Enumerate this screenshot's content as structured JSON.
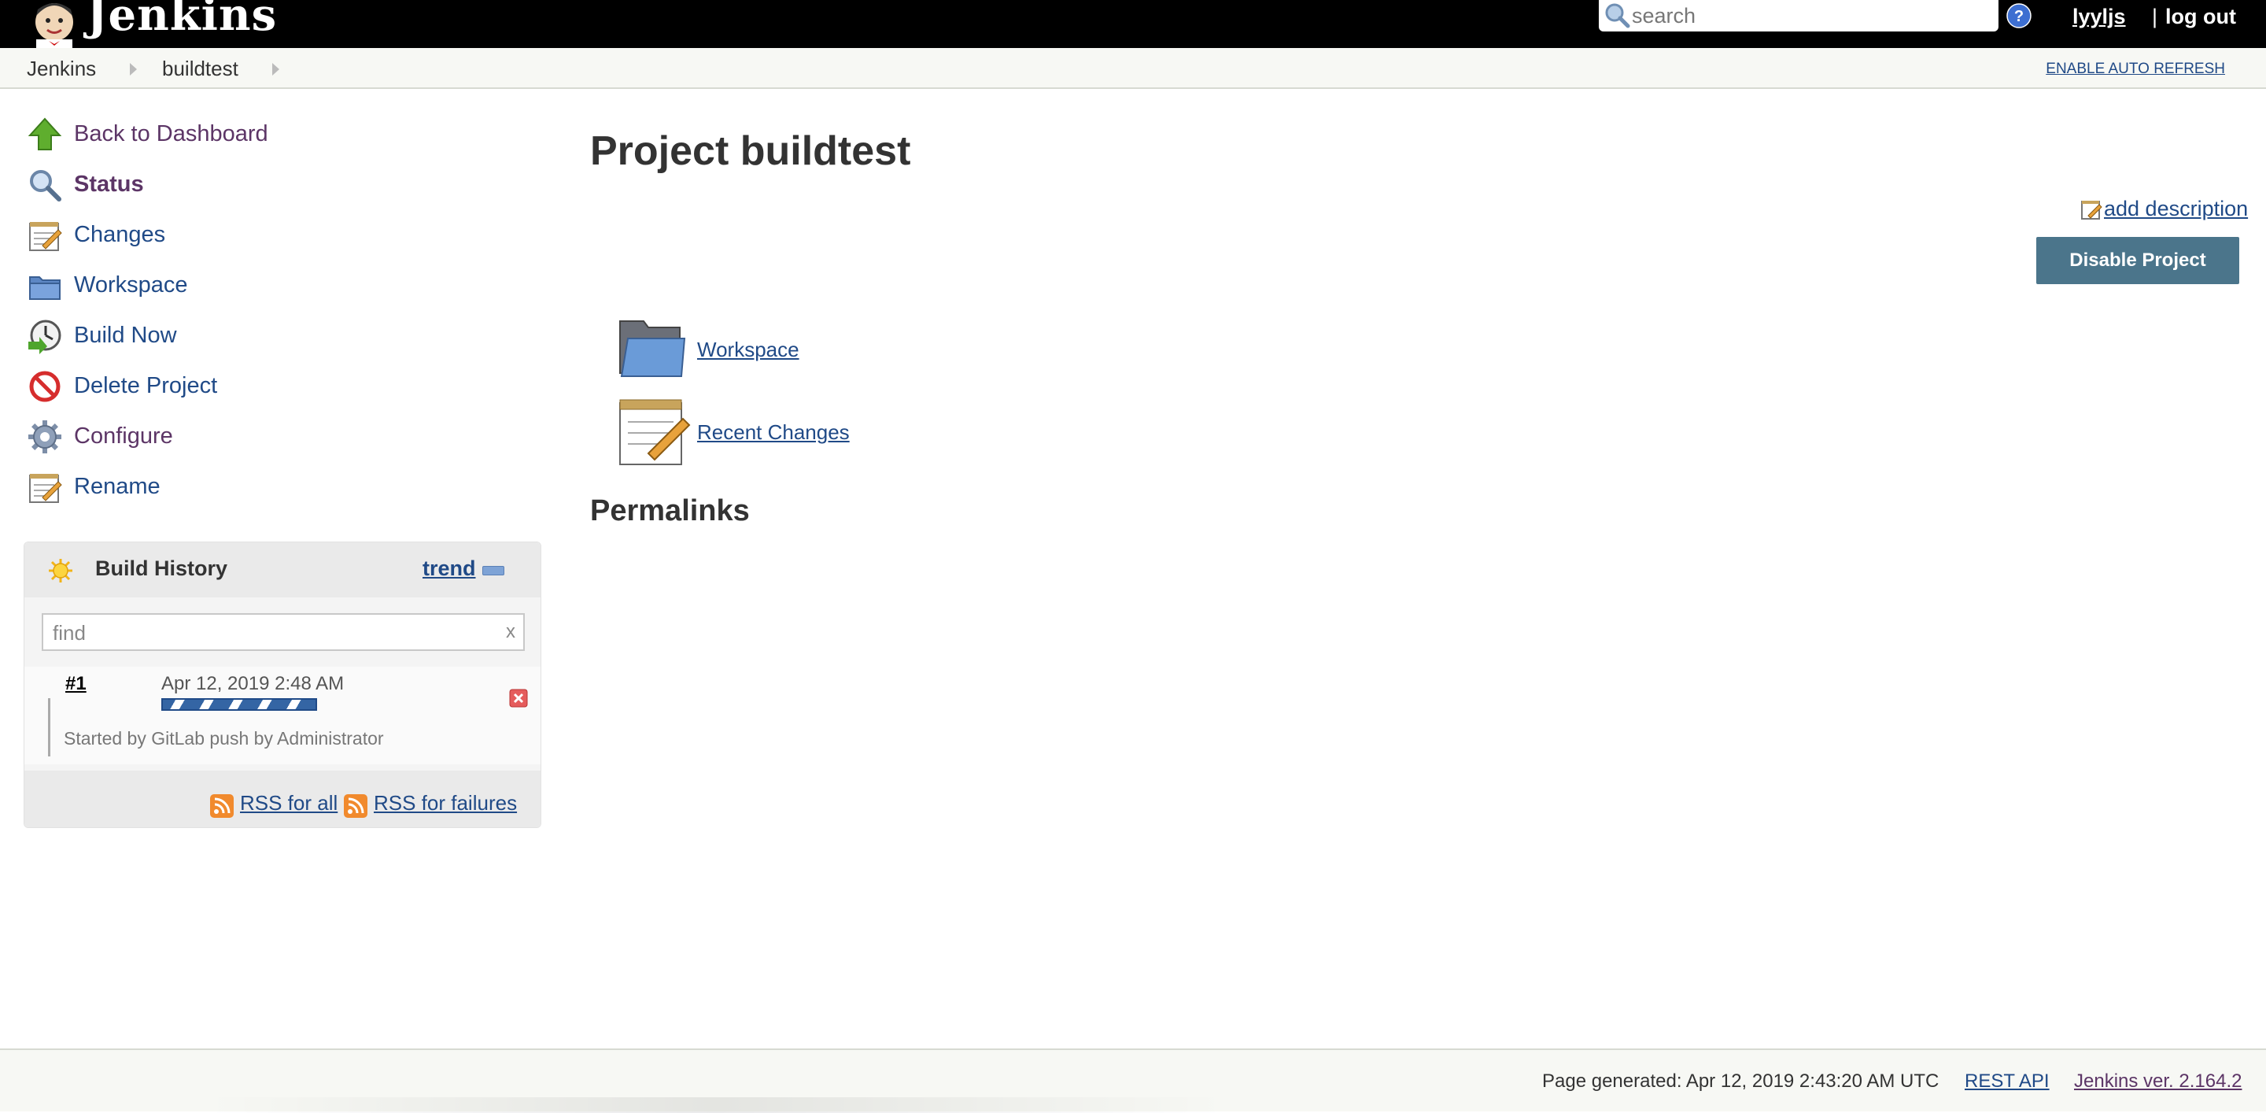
{
  "header": {
    "logo_title": "Jenkins",
    "search_placeholder": "search",
    "username": "lyyljs",
    "logout_separator": "|",
    "logout_label": "log out"
  },
  "breadcrumb": {
    "items": [
      "Jenkins",
      "buildtest"
    ],
    "auto_refresh_label": "ENABLE AUTO REFRESH"
  },
  "sidebar": {
    "tasks": [
      {
        "label": "Back to Dashboard",
        "icon": "up-arrow-icon"
      },
      {
        "label": "Status",
        "icon": "magnifier-icon"
      },
      {
        "label": "Changes",
        "icon": "notepad-icon"
      },
      {
        "label": "Workspace",
        "icon": "folder-icon"
      },
      {
        "label": "Build Now",
        "icon": "clock-icon"
      },
      {
        "label": "Delete Project",
        "icon": "no-entry-icon"
      },
      {
        "label": "Configure",
        "icon": "gear-icon"
      },
      {
        "label": "Rename",
        "icon": "notepad-icon"
      }
    ]
  },
  "build_history": {
    "title": "Build History",
    "trend_label": "trend",
    "find_placeholder": "find",
    "find_clear": "x",
    "builds": [
      {
        "number": "#1",
        "date": "Apr 12, 2019 2:48 AM",
        "cause": "Started by GitLab push by Administrator"
      }
    ],
    "rss_all_label": "RSS for all",
    "rss_failures_label": "RSS for failures"
  },
  "main": {
    "title": "Project buildtest",
    "add_description_label": "add description",
    "disable_button_label": "Disable Project",
    "links": [
      {
        "label": "Workspace",
        "icon": "folder-icon"
      },
      {
        "label": "Recent Changes",
        "icon": "notepad-icon"
      }
    ],
    "permalinks_heading": "Permalinks"
  },
  "footer": {
    "page_generated": "Page generated: Apr 12, 2019 2:43:20 AM UTC",
    "rest_api_label": "REST API",
    "version_label": "Jenkins ver. 2.164.2"
  },
  "colors": {
    "header_bg": "#000000",
    "link": "#204a87",
    "visited_link": "#5c3566",
    "button_bg": "#4b758b"
  }
}
